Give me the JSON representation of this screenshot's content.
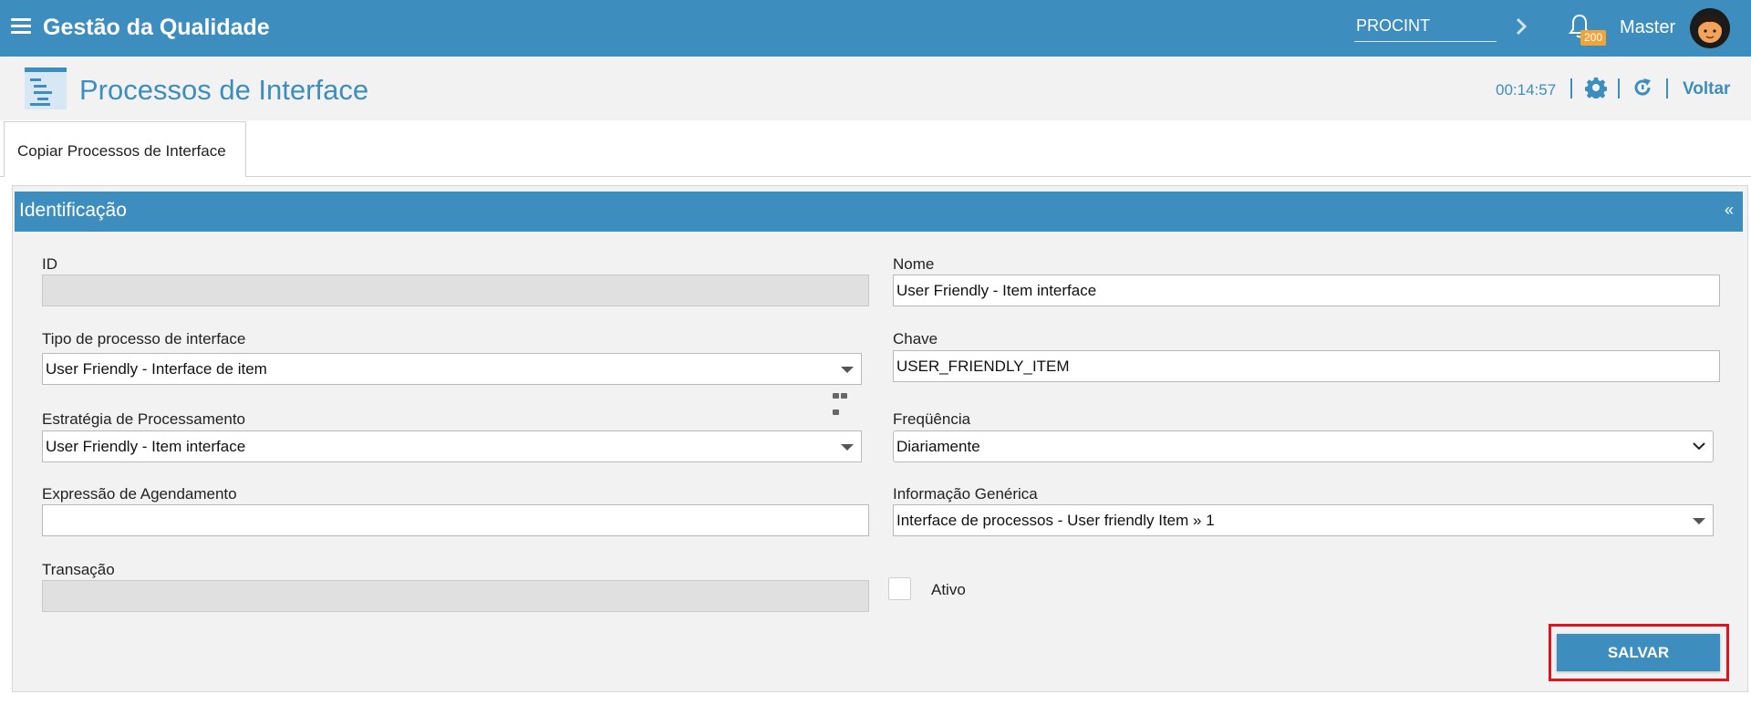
{
  "header": {
    "app_title": "Gestão da Qualidade",
    "unit_value": "PROCINT",
    "notification_count": "200",
    "user_name": "Master"
  },
  "titlebar": {
    "page_title": "Processos de Interface",
    "timer": "00:14:57",
    "back_label": "Voltar"
  },
  "tabs": [
    {
      "label": "Copiar Processos de Interface",
      "active": true
    }
  ],
  "section": {
    "title": "Identificação",
    "collapse_symbol": "«"
  },
  "form": {
    "id": {
      "label": "ID",
      "value": ""
    },
    "nome": {
      "label": "Nome",
      "value": "User Friendly - Item interface"
    },
    "tipo": {
      "label": "Tipo de processo de interface",
      "value": "User Friendly - Interface de item"
    },
    "chave": {
      "label": "Chave",
      "value": "USER_FRIENDLY_ITEM"
    },
    "estrategia": {
      "label": "Estratégia de Processamento",
      "value": "User Friendly - Item interface"
    },
    "frequencia": {
      "label": "Freqüência",
      "value": "Diariamente"
    },
    "expressao": {
      "label": "Expressão de Agendamento",
      "value": ""
    },
    "informacao": {
      "label": "Informação Genérica",
      "value": "Interface de processos - User friendly Item » 1"
    },
    "transacao": {
      "label": "Transação",
      "value": ""
    },
    "ativo": {
      "label": "Ativo",
      "checked": false
    }
  },
  "actions": {
    "save_label": "SALVAR"
  },
  "colors": {
    "primary": "#3d8ebf",
    "badge": "#f0a43a",
    "highlight": "#e0141e",
    "panel_bg": "#f2f2f2"
  },
  "icons": [
    "menu-icon",
    "chevron-right-icon",
    "bell-icon",
    "avatar",
    "page-icon",
    "gear-icon",
    "refresh-icon",
    "dropdown-caret-icon",
    "more-options-icon"
  ]
}
